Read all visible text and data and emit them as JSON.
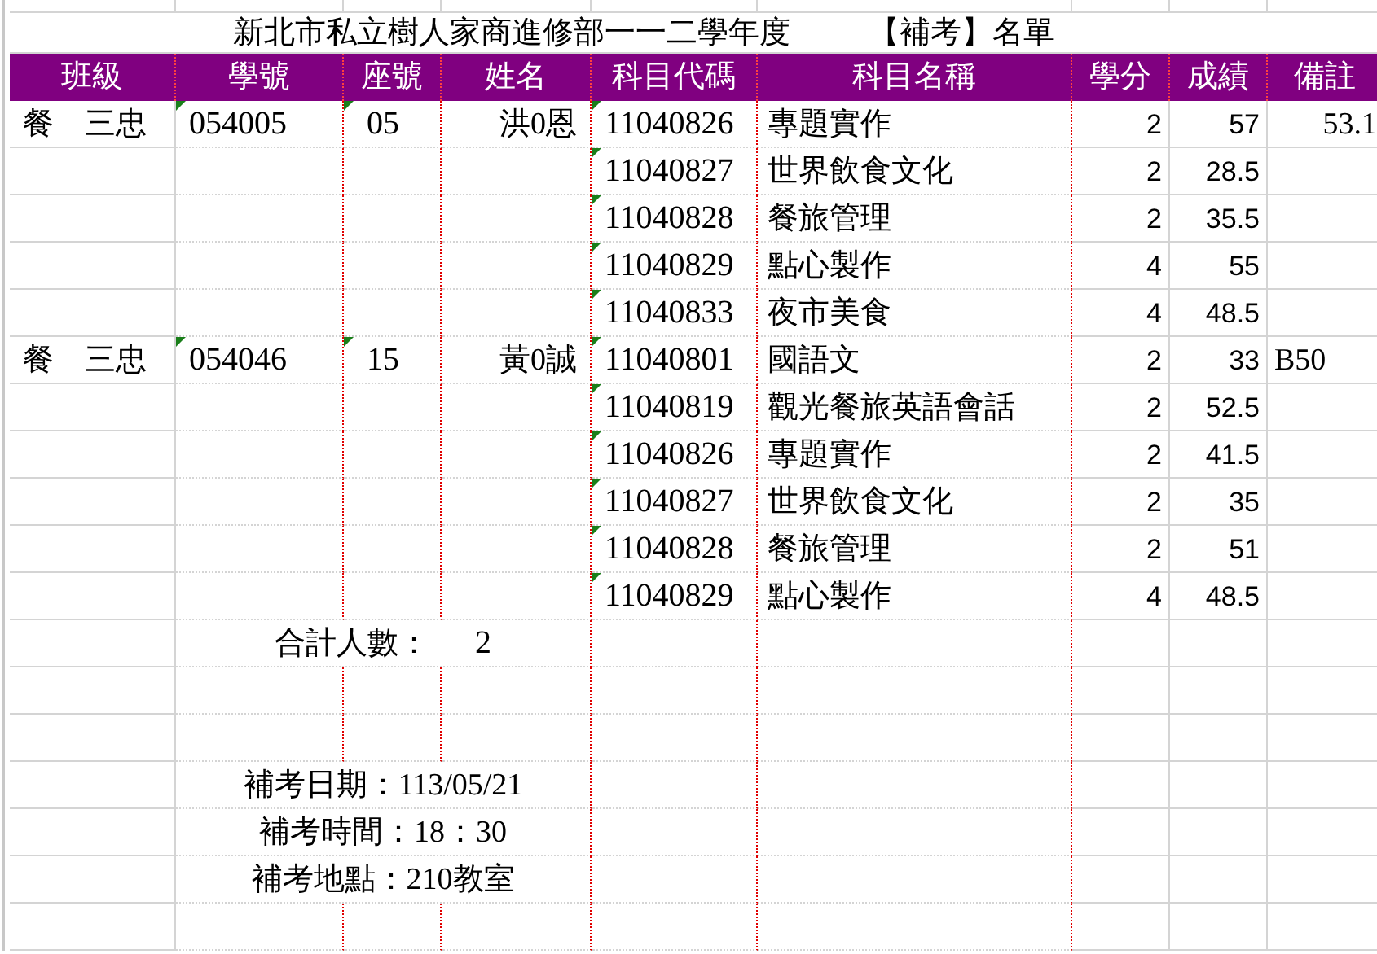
{
  "title": "新北市私立樹人家商進修部一一二學年度",
  "list_name": "【補考】名單",
  "columns": [
    "班級",
    "學號",
    "座號",
    "姓名",
    "科目代碼",
    "科目名稱",
    "學分",
    "成績",
    "備註"
  ],
  "students": [
    {
      "class": "餐　三忠",
      "id": "054005",
      "seat": "05",
      "name": "洪0恩",
      "flagged": true,
      "note": {
        "text": "53.1",
        "kind": "number"
      },
      "subjects": [
        {
          "code": "11040826",
          "name": "專題實作",
          "credit": "2",
          "score": "57",
          "flagged": true
        },
        {
          "code": "11040827",
          "name": "世界飲食文化",
          "credit": "2",
          "score": "28.5",
          "flagged": true
        },
        {
          "code": "11040828",
          "name": "餐旅管理",
          "credit": "2",
          "score": "35.5",
          "flagged": true
        },
        {
          "code": "11040829",
          "name": "點心製作",
          "credit": "4",
          "score": "55",
          "flagged": true
        },
        {
          "code": "11040833",
          "name": "夜市美食",
          "credit": "4",
          "score": "48.5",
          "flagged": true
        }
      ]
    },
    {
      "class": "餐　三忠",
      "id": "054046",
      "seat": "15",
      "name": "黃0誠",
      "flagged": true,
      "note": {
        "text": "B50",
        "kind": "text"
      },
      "subjects": [
        {
          "code": "11040801",
          "name": "國語文",
          "credit": "2",
          "score": "33",
          "flagged": true
        },
        {
          "code": "11040819",
          "name": "觀光餐旅英語會話",
          "credit": "2",
          "score": "52.5",
          "flagged": true
        },
        {
          "code": "11040826",
          "name": "專題實作",
          "credit": "2",
          "score": "41.5",
          "flagged": true
        },
        {
          "code": "11040827",
          "name": "世界飲食文化",
          "credit": "2",
          "score": "35",
          "flagged": true
        },
        {
          "code": "11040828",
          "name": "餐旅管理",
          "credit": "2",
          "score": "51",
          "flagged": true
        },
        {
          "code": "11040829",
          "name": "點心製作",
          "credit": "4",
          "score": "48.5",
          "flagged": true
        }
      ]
    }
  ],
  "total": {
    "label": "合計人數：",
    "value": "2"
  },
  "exam_info": [
    "補考日期：113/05/21",
    "補考時間：18：30",
    "補考地點：210教室"
  ]
}
